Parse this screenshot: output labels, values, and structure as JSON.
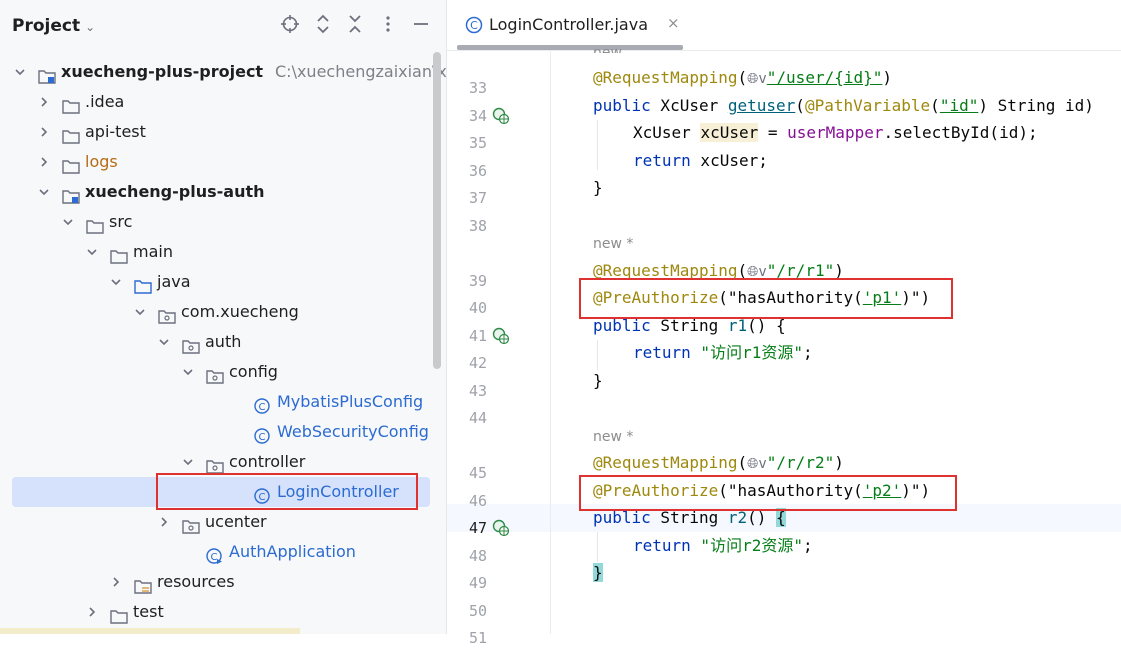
{
  "project_panel": {
    "title": "Project",
    "header_icons": [
      "crosshair-icon",
      "expand-all-icon",
      "collapse-all-icon",
      "more-icon",
      "minimize-icon"
    ],
    "tree": [
      {
        "label": "xuecheng-plus-project",
        "path": "C:\\xuechengzaixian\\xue",
        "type": "module",
        "expanded": true
      },
      {
        "label": ".idea",
        "type": "folder"
      },
      {
        "label": "api-test",
        "type": "folder"
      },
      {
        "label": "logs",
        "type": "folder"
      },
      {
        "label": "xuecheng-plus-auth",
        "type": "module",
        "expanded": true
      },
      {
        "label": "src",
        "type": "folder",
        "expanded": true
      },
      {
        "label": "main",
        "type": "folder",
        "expanded": true
      },
      {
        "label": "java",
        "type": "source-folder",
        "expanded": true
      },
      {
        "label": "com.xuecheng",
        "type": "package",
        "expanded": true
      },
      {
        "label": "auth",
        "type": "package",
        "expanded": true
      },
      {
        "label": "config",
        "type": "package",
        "expanded": true
      },
      {
        "label": "MybatisPlusConfig",
        "type": "class"
      },
      {
        "label": "WebSecurityConfig",
        "type": "class"
      },
      {
        "label": "controller",
        "type": "package",
        "expanded": true
      },
      {
        "label": "LoginController",
        "type": "class",
        "selected": true
      },
      {
        "label": "ucenter",
        "type": "package"
      },
      {
        "label": "AuthApplication",
        "type": "app-class"
      },
      {
        "label": "resources",
        "type": "resources-folder"
      },
      {
        "label": "test",
        "type": "folder"
      }
    ]
  },
  "editor": {
    "tab": {
      "label": "LoginController.java",
      "close": "×"
    },
    "usage_hints": {
      "top": "new",
      "r1": "new *",
      "r2": "new *"
    },
    "line_numbers": [
      "33",
      "34",
      "35",
      "36",
      "37",
      "38",
      "39",
      "40",
      "41",
      "42",
      "43",
      "44",
      "45",
      "46",
      "47",
      "48",
      "49",
      "50",
      "51"
    ],
    "current_line": "47",
    "code": {
      "l33": {
        "anno": "@RequestMapping",
        "open": "(",
        "arrow": "v",
        "path": "\"/user/{id}\"",
        "close": ")"
      },
      "l34": {
        "kw": "public",
        "type": " XcUser ",
        "fn": "getuser",
        "p1": "(",
        "anno": "@PathVariable",
        "p2": "(",
        "str": "\"id\"",
        "rest": ") String id)"
      },
      "l35": {
        "type": "XcUser ",
        "var": "xcUser",
        "eq": " = ",
        "fld": "userMapper",
        "rest": ".selectById(id);"
      },
      "l36": {
        "kw": "return",
        "rest": " xcUser;"
      },
      "l37": {
        "brace": "}"
      },
      "l39": {
        "anno": "@RequestMapping",
        "open": "(",
        "arrow": "v",
        "path": "\"/r/r1\"",
        "close": ")"
      },
      "l40": {
        "anno": "@PreAuthorize",
        "open": "(",
        "s1": "\"hasAuthority(",
        "s2": "'p1'",
        "s3": ")\"",
        "close": ")"
      },
      "l41": {
        "kw": "public",
        "type": " String ",
        "fn": "r1",
        "rest": "() {"
      },
      "l42": {
        "kw": "return",
        "str": " \"访问r1资源\"",
        "rest": ";"
      },
      "l43": {
        "brace": "}"
      },
      "l45": {
        "anno": "@RequestMapping",
        "open": "(",
        "arrow": "v",
        "path": "\"/r/r2\"",
        "close": ")"
      },
      "l46": {
        "anno": "@PreAuthorize",
        "open": "(",
        "s1": "\"hasAuthority(",
        "s2": "'p2'",
        "s3": ")\"",
        "close": ")"
      },
      "l47": {
        "kw": "public",
        "type": " String ",
        "fn": "r2",
        "rest": "() ",
        "brace": "{"
      },
      "l48": {
        "kw": "return",
        "str": " \"访问r2资源\"",
        "rest": ";"
      },
      "l49": {
        "brace": "}"
      }
    }
  },
  "colors": {
    "highlight_box": "#e03131",
    "selection": "#d6e2fb",
    "class_icon": "#2c6bd1"
  }
}
